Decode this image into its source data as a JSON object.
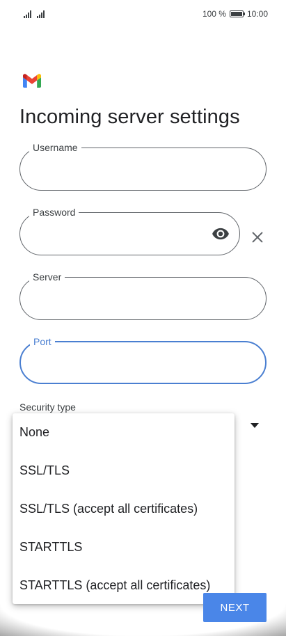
{
  "status_bar": {
    "battery_percent": "100 %",
    "time": "10:00"
  },
  "page": {
    "title": "Incoming server settings"
  },
  "form": {
    "username": {
      "label": "Username",
      "value": ""
    },
    "password": {
      "label": "Password",
      "value": ""
    },
    "server": {
      "label": "Server",
      "value": ""
    },
    "port": {
      "label": "Port",
      "value": ""
    },
    "security_type": {
      "label": "Security type"
    }
  },
  "dropdown": {
    "options": [
      "None",
      "SSL/TLS",
      "SSL/TLS (accept all certificates)",
      "STARTTLS",
      "STARTTLS (accept all certificates)"
    ]
  },
  "actions": {
    "next_label": "NEXT"
  },
  "colors": {
    "accent": "#4a86e8",
    "focus_border": "#4a7fd1",
    "gmail_red": "#ea4335",
    "gmail_blue": "#4285f4",
    "gmail_green": "#34a853",
    "gmail_yellow": "#fbbc04"
  },
  "icons": {
    "signal": "signal-icon",
    "battery": "battery-icon",
    "logo": "gmail-logo",
    "eye": "eye-icon",
    "clear": "close-icon",
    "dropdown": "dropdown-arrow-icon"
  }
}
